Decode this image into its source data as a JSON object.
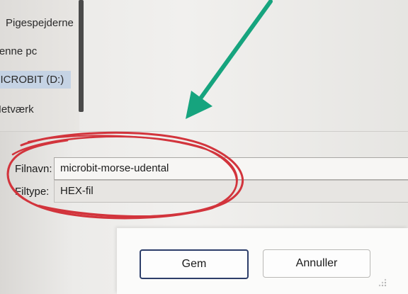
{
  "nav": {
    "items": [
      {
        "label": "Pigespejderne"
      },
      {
        "label": "Denne pc"
      },
      {
        "label": "MICROBIT (D:)"
      },
      {
        "label": "Netværk"
      }
    ]
  },
  "form": {
    "filename_label": "Filnavn:",
    "filename_value": "microbit-morse-udental",
    "filetype_label": "Filtype:",
    "filetype_value": "HEX-fil"
  },
  "buttons": {
    "save": "Gem",
    "cancel": "Annuller"
  },
  "annotations": {
    "arrow_color": "#16a47e",
    "circle_color": "#d2343c"
  }
}
